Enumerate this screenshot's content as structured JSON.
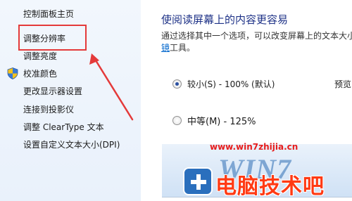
{
  "sidebar": {
    "items": [
      {
        "label": "控制面板主页"
      },
      {
        "label": "调整分辨率"
      },
      {
        "label": "调整亮度"
      },
      {
        "label": "校准颜色"
      },
      {
        "label": "更改显示器设置"
      },
      {
        "label": "连接到投影仪"
      },
      {
        "label": "调整 ClearType 文本"
      },
      {
        "label": "设置自定义文本大小(DPI)"
      }
    ]
  },
  "main": {
    "heading": "使阅读屏幕上的内容更容易",
    "description_line1": "通过选择其中一个选项，可以改变屏幕上的文本大小",
    "description_line2_link": "镜",
    "description_line2_rest": "工具。",
    "options": [
      {
        "label": "较小(S) - 100% (默认)",
        "checked": true
      },
      {
        "label": "中等(M) - 125%",
        "checked": false
      }
    ],
    "preview_label": "预览"
  },
  "preview_panel": {
    "logo_text": "WIN7"
  },
  "watermark": {
    "url": "www.win7zhijia.cn",
    "brand": "电脑技术吧"
  },
  "annotation": {
    "color": "#e43a3a"
  }
}
